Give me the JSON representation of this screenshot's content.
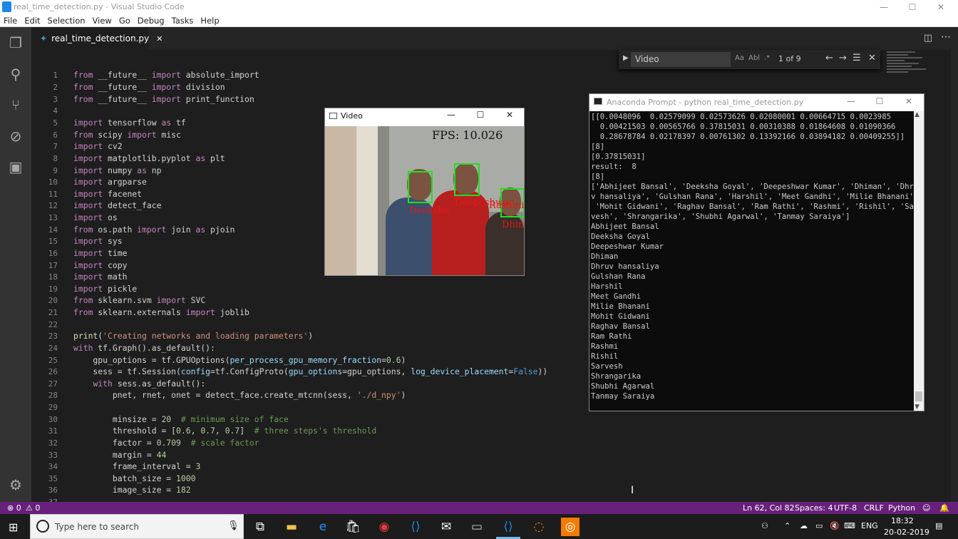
{
  "window": {
    "title": "real_time_detection.py - Visual Studio Code",
    "minimize": "—",
    "maximize": "☐",
    "close": "✕"
  },
  "menu": [
    "File",
    "Edit",
    "Selection",
    "View",
    "Go",
    "Debug",
    "Tasks",
    "Help"
  ],
  "activity_icons": [
    "files-icon",
    "search-icon",
    "source-control-icon",
    "debug-icon",
    "extensions-icon",
    "settings-gear-icon"
  ],
  "tab": {
    "name": "real_time_detection.py",
    "close": "✕"
  },
  "find": {
    "query": "Video",
    "aa": "Aa",
    "ab": "Abl",
    "regex": ".*",
    "count": "1 of 9",
    "prev": "←",
    "next": "→",
    "sel": "☰",
    "close": "✕"
  },
  "line_numbers": [
    "1",
    "2",
    "3",
    "4",
    "5",
    "6",
    "7",
    "8",
    "9",
    "10",
    "11",
    "12",
    "13",
    "14",
    "15",
    "16",
    "17",
    "18",
    "19",
    "20",
    "21",
    "22",
    "23",
    "24",
    "25",
    "26",
    "27",
    "28",
    "29",
    "30",
    "31",
    "32",
    "33",
    "34",
    "35",
    "36",
    "37"
  ],
  "video_window": {
    "title": "Video",
    "fps": "FPS: 10.026",
    "labels": [
      "Deeksha",
      "Deepeshwar",
      "Rashmi",
      "Dhiman"
    ]
  },
  "console_window": {
    "title": "Anaconda Prompt - python  real_time_detection.py",
    "lines": [
      "[[0.0048096  0.02579099 0.02573626 0.02080001 0.00664715 0.0023985",
      "  0.00421503 0.00565766 0.37815031 0.00310388 0.01864608 0.01090366",
      "  0.28678784 0.02178397 0.00761302 0.13392166 0.03894182 0.00409255]]",
      "[8]",
      "[0.37815031]",
      "result:  8",
      "[8]",
      "['Abhijeet Bansal', 'Deeksha Goyal', 'Deepeshwar Kumar', 'Dhiman', 'Dhru",
      "v hansaliya', 'Gulshan Rana', 'Harshil', 'Meet Gandhi', 'Milie Bhanani',",
      " 'Mohit Gidwani', 'Raghav Bansal', 'Ram Rathi', 'Rashmi', 'Rishil', 'Sar",
      "vesh', 'Shrangarika', 'Shubhi Agarwal', 'Tanmay Saraiya']",
      "Abhijeet Bansal",
      "Deeksha Goyal",
      "Deepeshwar Kumar",
      "Dhiman",
      "Dhruv hansaliya",
      "Gulshan Rana",
      "Harshil",
      "Meet Gandhi",
      "Milie Bhanani",
      "Mohit Gidwani",
      "Raghav Bansal",
      "Ram Rathi",
      "Rashmi",
      "Rishil",
      "Sarvesh",
      "Shrangarika",
      "Shubhi Agarwal",
      "Tanmay Saraiya"
    ]
  },
  "status": {
    "errors": "⊗ 0",
    "warnings": "⚠ 0",
    "position": "Ln 62, Col 82",
    "spaces": "Spaces: 4",
    "encoding": "UTF-8",
    "eol": "CRLF",
    "language": "Python"
  },
  "taskbar": {
    "search_placeholder": "Type here to search",
    "lang": "ENG",
    "time": "18:32",
    "date": "20-02-2019",
    "apps": [
      "task-view-icon",
      "file-explorer-icon",
      "edge-icon",
      "store-icon",
      "chrome-icon",
      "vscode-icon",
      "mail-icon",
      "terminal-icon",
      "vscode-icon",
      "jupyter-icon",
      "app-icon"
    ]
  },
  "colors": {
    "statusbar": "#68217a",
    "editor_bg": "#1e1e1e",
    "keyword": "#c586c0",
    "string": "#ce9178"
  }
}
